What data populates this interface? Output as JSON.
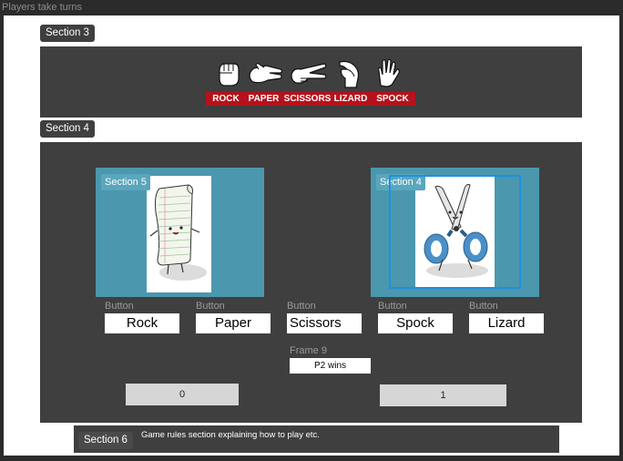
{
  "window": {
    "title": "Players take turns"
  },
  "sections": {
    "section3": "Section 3",
    "section4": "Section 4",
    "section5": "Section 5",
    "section4_card": "Section 4",
    "section6": "Section 6"
  },
  "gestures": [
    {
      "label": "ROCK",
      "icon": "fist-icon"
    },
    {
      "label": "PAPER",
      "icon": "flat-hand-icon"
    },
    {
      "label": "SCISSORS",
      "icon": "scissors-hand-icon"
    },
    {
      "label": "LIZARD",
      "icon": "lizard-hand-icon"
    },
    {
      "label": "SPOCK",
      "icon": "spock-hand-icon"
    }
  ],
  "players": {
    "left_choice_image": "paper-character",
    "right_choice_image": "scissors-character"
  },
  "buttons": [
    {
      "caption": "Button",
      "label": "Rock"
    },
    {
      "caption": "Button",
      "label": "Paper"
    },
    {
      "caption": "Button",
      "label": "Scissors"
    },
    {
      "caption": "Button",
      "label": "Spock"
    },
    {
      "caption": "Button",
      "label": "Lizard"
    }
  ],
  "result": {
    "frame_label": "Frame 9",
    "text": "P2 wins"
  },
  "scores": {
    "player1": "0",
    "player2": "1"
  },
  "rules": {
    "text": "Game rules section explaining how to play etc."
  },
  "colors": {
    "panel": "#3f3f3f",
    "card": "#4b97ad",
    "label_red": "#b5121b",
    "selection": "#1e8fe0"
  }
}
